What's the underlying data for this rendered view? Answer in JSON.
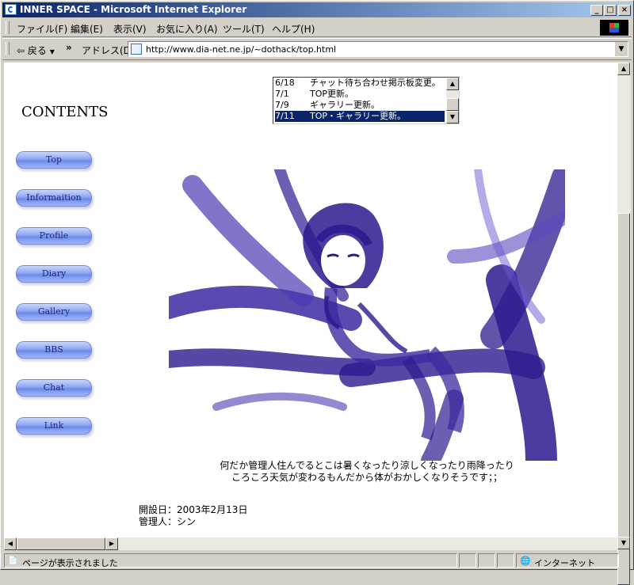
{
  "window": {
    "title": "INNER SPACE - Microsoft Internet Explorer"
  },
  "menu": [
    "ファイル(F)",
    "編集(E)",
    "表示(V)",
    "お気に入り(A)",
    "ツール(T)",
    "ヘルプ(H)"
  ],
  "toolbar": {
    "back_label": "戻る",
    "chevron": "»"
  },
  "address": {
    "label": "アドレス(D)",
    "url": "http://www.dia-net.ne.jp/~dothack/top.html"
  },
  "page": {
    "contents_heading": "CONTENTS",
    "nav": [
      "Top",
      "Informaition",
      "Profile",
      "Diary",
      "Gallery",
      "BBS",
      "Chat",
      "Link"
    ],
    "news": [
      {
        "date": "6/18",
        "text": "チャット待ち合わせ掲示板変更。"
      },
      {
        "date": "7/1",
        "text": "TOP更新。"
      },
      {
        "date": "7/9",
        "text": "ギャラリー更新。"
      },
      {
        "date": "7/11",
        "text": "TOP・ギャラリー更新。"
      }
    ],
    "news_selected_index": 3,
    "caption_line1": "何だか管理人住んでるとこは暑くなったり涼しくなったり雨降ったり",
    "caption_line2": "ころころ天気が変わるもんだから体がおかしくなりそうです；；",
    "opened": "開設日：2003年2月13日",
    "admin": "管理人：シン",
    "art_color": "#2e1a8f"
  },
  "status": {
    "text": "ページが表示されました",
    "zone": "インターネット"
  }
}
